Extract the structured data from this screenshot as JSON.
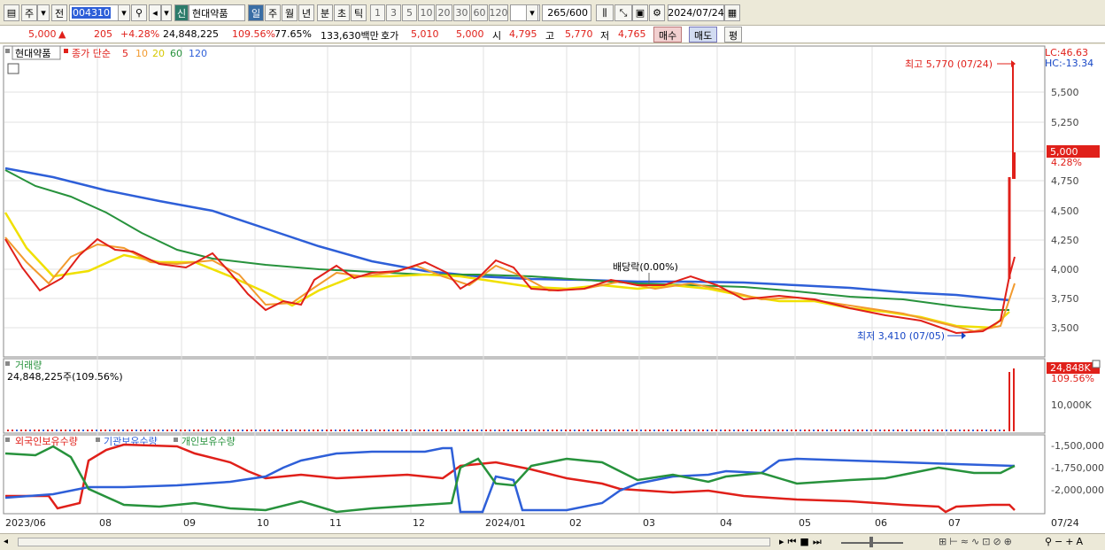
{
  "toolbar": {
    "mode_label": "주",
    "jeon_label": "전",
    "code": "004310",
    "new_badge": "신",
    "stock_name": "현대약품",
    "periods": [
      "일",
      "주",
      "월",
      "년",
      "분",
      "초",
      "틱"
    ],
    "active_period": "일",
    "intervals": [
      "1",
      "3",
      "5",
      "10",
      "20",
      "30",
      "60",
      "120"
    ],
    "count": "265",
    "count_total": "/600",
    "date": "2024/07/24"
  },
  "quote": {
    "price": "5,000",
    "arrow": "▲",
    "change": "205",
    "change_pct": "+4.28%",
    "volume": "24,848,225",
    "vol_ratio": "109.56%",
    "turnover": "77.65%",
    "amount": "133,630백만",
    "bid_label": "호가",
    "bid1": "5,010",
    "bid2": "5,000",
    "open_label": "시",
    "open": "4,795",
    "high_label": "고",
    "high": "5,770",
    "low_label": "저",
    "low": "4,765",
    "buy_label": "매수",
    "sell_label": "매도",
    "avg_label": "평"
  },
  "legend": {
    "name": "현대약품",
    "close_label": "종가 단순",
    "ma": [
      "5",
      "10",
      "20",
      "60",
      "120"
    ],
    "ma_colors": [
      "#e0201a",
      "#f29a2e",
      "#f0e000",
      "#27923c",
      "#2e5fd8"
    ]
  },
  "price_axis": {
    "lc": "LC:46.63",
    "hc": "HC:-13.34",
    "ticks": [
      "5,500",
      "5,250",
      "5,000",
      "4,750",
      "4,500",
      "4,250",
      "4,000",
      "3,750",
      "3,500"
    ],
    "current": "5,000",
    "current_pct": "4.28%"
  },
  "annotations": {
    "high": "최고 5,770 (07/24)",
    "low": "최저 3,410 (07/05)",
    "dividend": "배당락(0.00%)"
  },
  "volume_panel": {
    "title": "거래량",
    "value": "24,848,225주(109.56%)",
    "current": "24,848K",
    "current_pct": "109.56%",
    "tick": "10,000K"
  },
  "holding_panel": {
    "series": [
      "외국인보유수량",
      "기관보유수량",
      "개인보유수량"
    ],
    "series_colors": [
      "#e0201a",
      "#2e5fd8",
      "#27923c"
    ],
    "ticks": [
      "-1,500,000",
      "-1,750,000",
      "-2,000,000"
    ]
  },
  "x_axis": {
    "labels": [
      "2023/06",
      "08",
      "09",
      "10",
      "11",
      "12",
      "2024/01",
      "02",
      "03",
      "04",
      "05",
      "06",
      "07"
    ],
    "right_label": "07/24"
  }
}
